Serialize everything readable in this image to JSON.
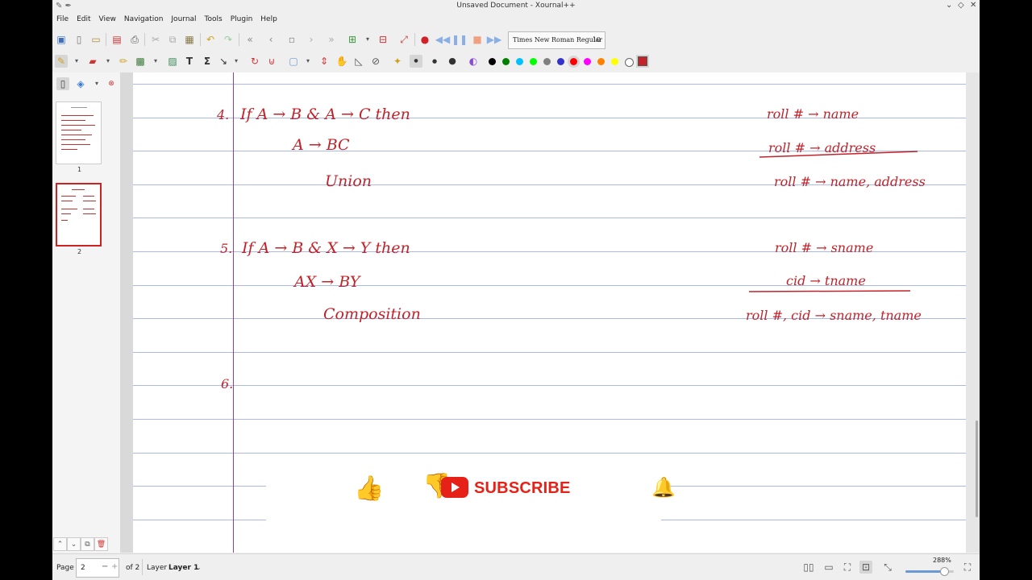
{
  "window": {
    "title": "Unsaved Document - Xournal++"
  },
  "menu": [
    "File",
    "Edit",
    "View",
    "Navigation",
    "Journal",
    "Tools",
    "Plugin",
    "Help"
  ],
  "font": {
    "name": "Times New Roman Regular",
    "size": "10"
  },
  "colors": {
    "accent": "#c0232a",
    "ink": "#c0232a",
    "palette": [
      "#000000",
      "#008000",
      "#00c0ff",
      "#00ff00",
      "#808080",
      "#3333cc",
      "#ff0000",
      "#ff00ff",
      "#ff8000",
      "#ffff00",
      "#ffffff"
    ],
    "palette_selected": "#ff0000",
    "rule": "#aab9e8",
    "margin": "#9a3a9a"
  },
  "sidebar": {
    "pages": [
      {
        "label": "1"
      },
      {
        "label": "2",
        "selected": true
      }
    ]
  },
  "notes": {
    "item4": {
      "number": "4.",
      "rule": "If   A → B   &   A → C   then",
      "result": "A → BC",
      "name": "Union",
      "example": [
        "roll # → name",
        "roll # → address",
        "roll # → name, address"
      ]
    },
    "item5": {
      "number": "5.",
      "rule": "If   A → B   &   X → Y   then",
      "result": "AX → BY",
      "name": "Composition",
      "example": [
        "roll # → sname",
        "cid → tname",
        "roll #, cid → sname, tname"
      ]
    },
    "item6": {
      "number": "6."
    }
  },
  "overlay": {
    "subscribe_label": "SUBSCRIBE"
  },
  "statusbar": {
    "page_label": "Page",
    "page_value": "2",
    "page_of": "of 2",
    "layer_label": "Layer",
    "layer_value": "Layer 1",
    "zoom": "288%",
    "zoom_fraction": 0.8
  }
}
